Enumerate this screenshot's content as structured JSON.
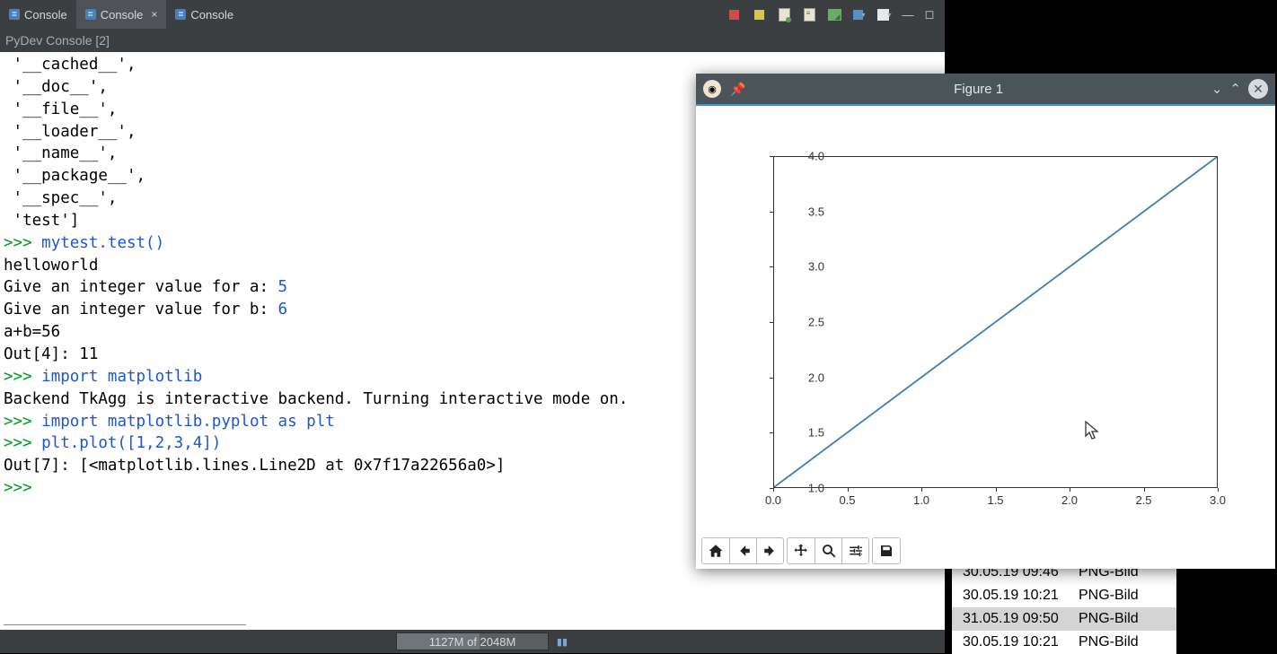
{
  "tabs": [
    {
      "label": "Console",
      "active": false
    },
    {
      "label": "Console",
      "active": true
    },
    {
      "label": "Console",
      "active": false
    }
  ],
  "subtitle": "PyDev Console [2]",
  "console_lines": [
    {
      "segs": [
        {
          "t": " '__cached__',",
          "c": "black"
        }
      ]
    },
    {
      "segs": [
        {
          "t": " '__doc__',",
          "c": "black"
        }
      ]
    },
    {
      "segs": [
        {
          "t": " '__file__',",
          "c": "black"
        }
      ]
    },
    {
      "segs": [
        {
          "t": " '__loader__',",
          "c": "black"
        }
      ]
    },
    {
      "segs": [
        {
          "t": " '__name__',",
          "c": "black"
        }
      ]
    },
    {
      "segs": [
        {
          "t": " '__package__',",
          "c": "black"
        }
      ]
    },
    {
      "segs": [
        {
          "t": " '__spec__',",
          "c": "black"
        }
      ]
    },
    {
      "segs": [
        {
          "t": " 'test']",
          "c": "black"
        }
      ]
    },
    {
      "segs": [
        {
          "t": ">>> ",
          "c": "green"
        },
        {
          "t": "mytest.test()",
          "c": "blue"
        }
      ]
    },
    {
      "segs": [
        {
          "t": "helloworld",
          "c": "black"
        }
      ]
    },
    {
      "segs": [
        {
          "t": "Give an integer value for a: ",
          "c": "black"
        },
        {
          "t": "5",
          "c": "blue"
        }
      ]
    },
    {
      "segs": [
        {
          "t": "Give an integer value for b: ",
          "c": "black"
        },
        {
          "t": "6",
          "c": "blue"
        }
      ]
    },
    {
      "segs": [
        {
          "t": "a+b=56",
          "c": "black"
        }
      ]
    },
    {
      "segs": [
        {
          "t": "Out[4]: 11",
          "c": "black"
        }
      ]
    },
    {
      "segs": [
        {
          "t": ">>> ",
          "c": "green"
        },
        {
          "t": "import matplotlib",
          "c": "blue"
        }
      ]
    },
    {
      "segs": [
        {
          "t": "Backend TkAgg is interactive backend. Turning interactive mode on.",
          "c": "black"
        }
      ]
    },
    {
      "segs": [
        {
          "t": ">>> ",
          "c": "green"
        },
        {
          "t": "import matplotlib.pyplot as plt",
          "c": "blue"
        }
      ]
    },
    {
      "segs": [
        {
          "t": ">>> ",
          "c": "green"
        },
        {
          "t": "plt.plot([1,2,3,4])",
          "c": "blue"
        }
      ]
    },
    {
      "segs": [
        {
          "t": "Out[7]: [<matplotlib.lines.Line2D at 0x7f17a22656a0>]",
          "c": "black"
        }
      ]
    },
    {
      "segs": [
        {
          "t": ">>> ",
          "c": "green"
        }
      ]
    }
  ],
  "memory": {
    "text": "1127M of 2048M"
  },
  "figure": {
    "title": "Figure 1",
    "toolbar": {
      "home": "⌂",
      "back": "←",
      "forward": "→",
      "pan": "✥",
      "zoom": "⚲",
      "config": "≡",
      "save": "💾"
    }
  },
  "chart_data": {
    "type": "line",
    "x": [
      0,
      1,
      2,
      3
    ],
    "values": [
      1,
      2,
      3,
      4
    ],
    "x_ticks": [
      0.0,
      0.5,
      1.0,
      1.5,
      2.0,
      2.5,
      3.0
    ],
    "y_ticks": [
      1.0,
      1.5,
      2.0,
      2.5,
      3.0,
      3.5,
      4.0
    ],
    "xlim": [
      0,
      3
    ],
    "ylim": [
      1,
      4
    ],
    "title": "",
    "xlabel": "",
    "ylabel": ""
  },
  "files": [
    {
      "date": "30.05.19 09:46",
      "type": "PNG-Bild",
      "sel": false
    },
    {
      "date": "30.05.19 10:21",
      "type": "PNG-Bild",
      "sel": false
    },
    {
      "date": "31.05.19 09:50",
      "type": "PNG-Bild",
      "sel": true
    },
    {
      "date": "30.05.19 10:21",
      "type": "PNG-Bild",
      "sel": false
    }
  ]
}
